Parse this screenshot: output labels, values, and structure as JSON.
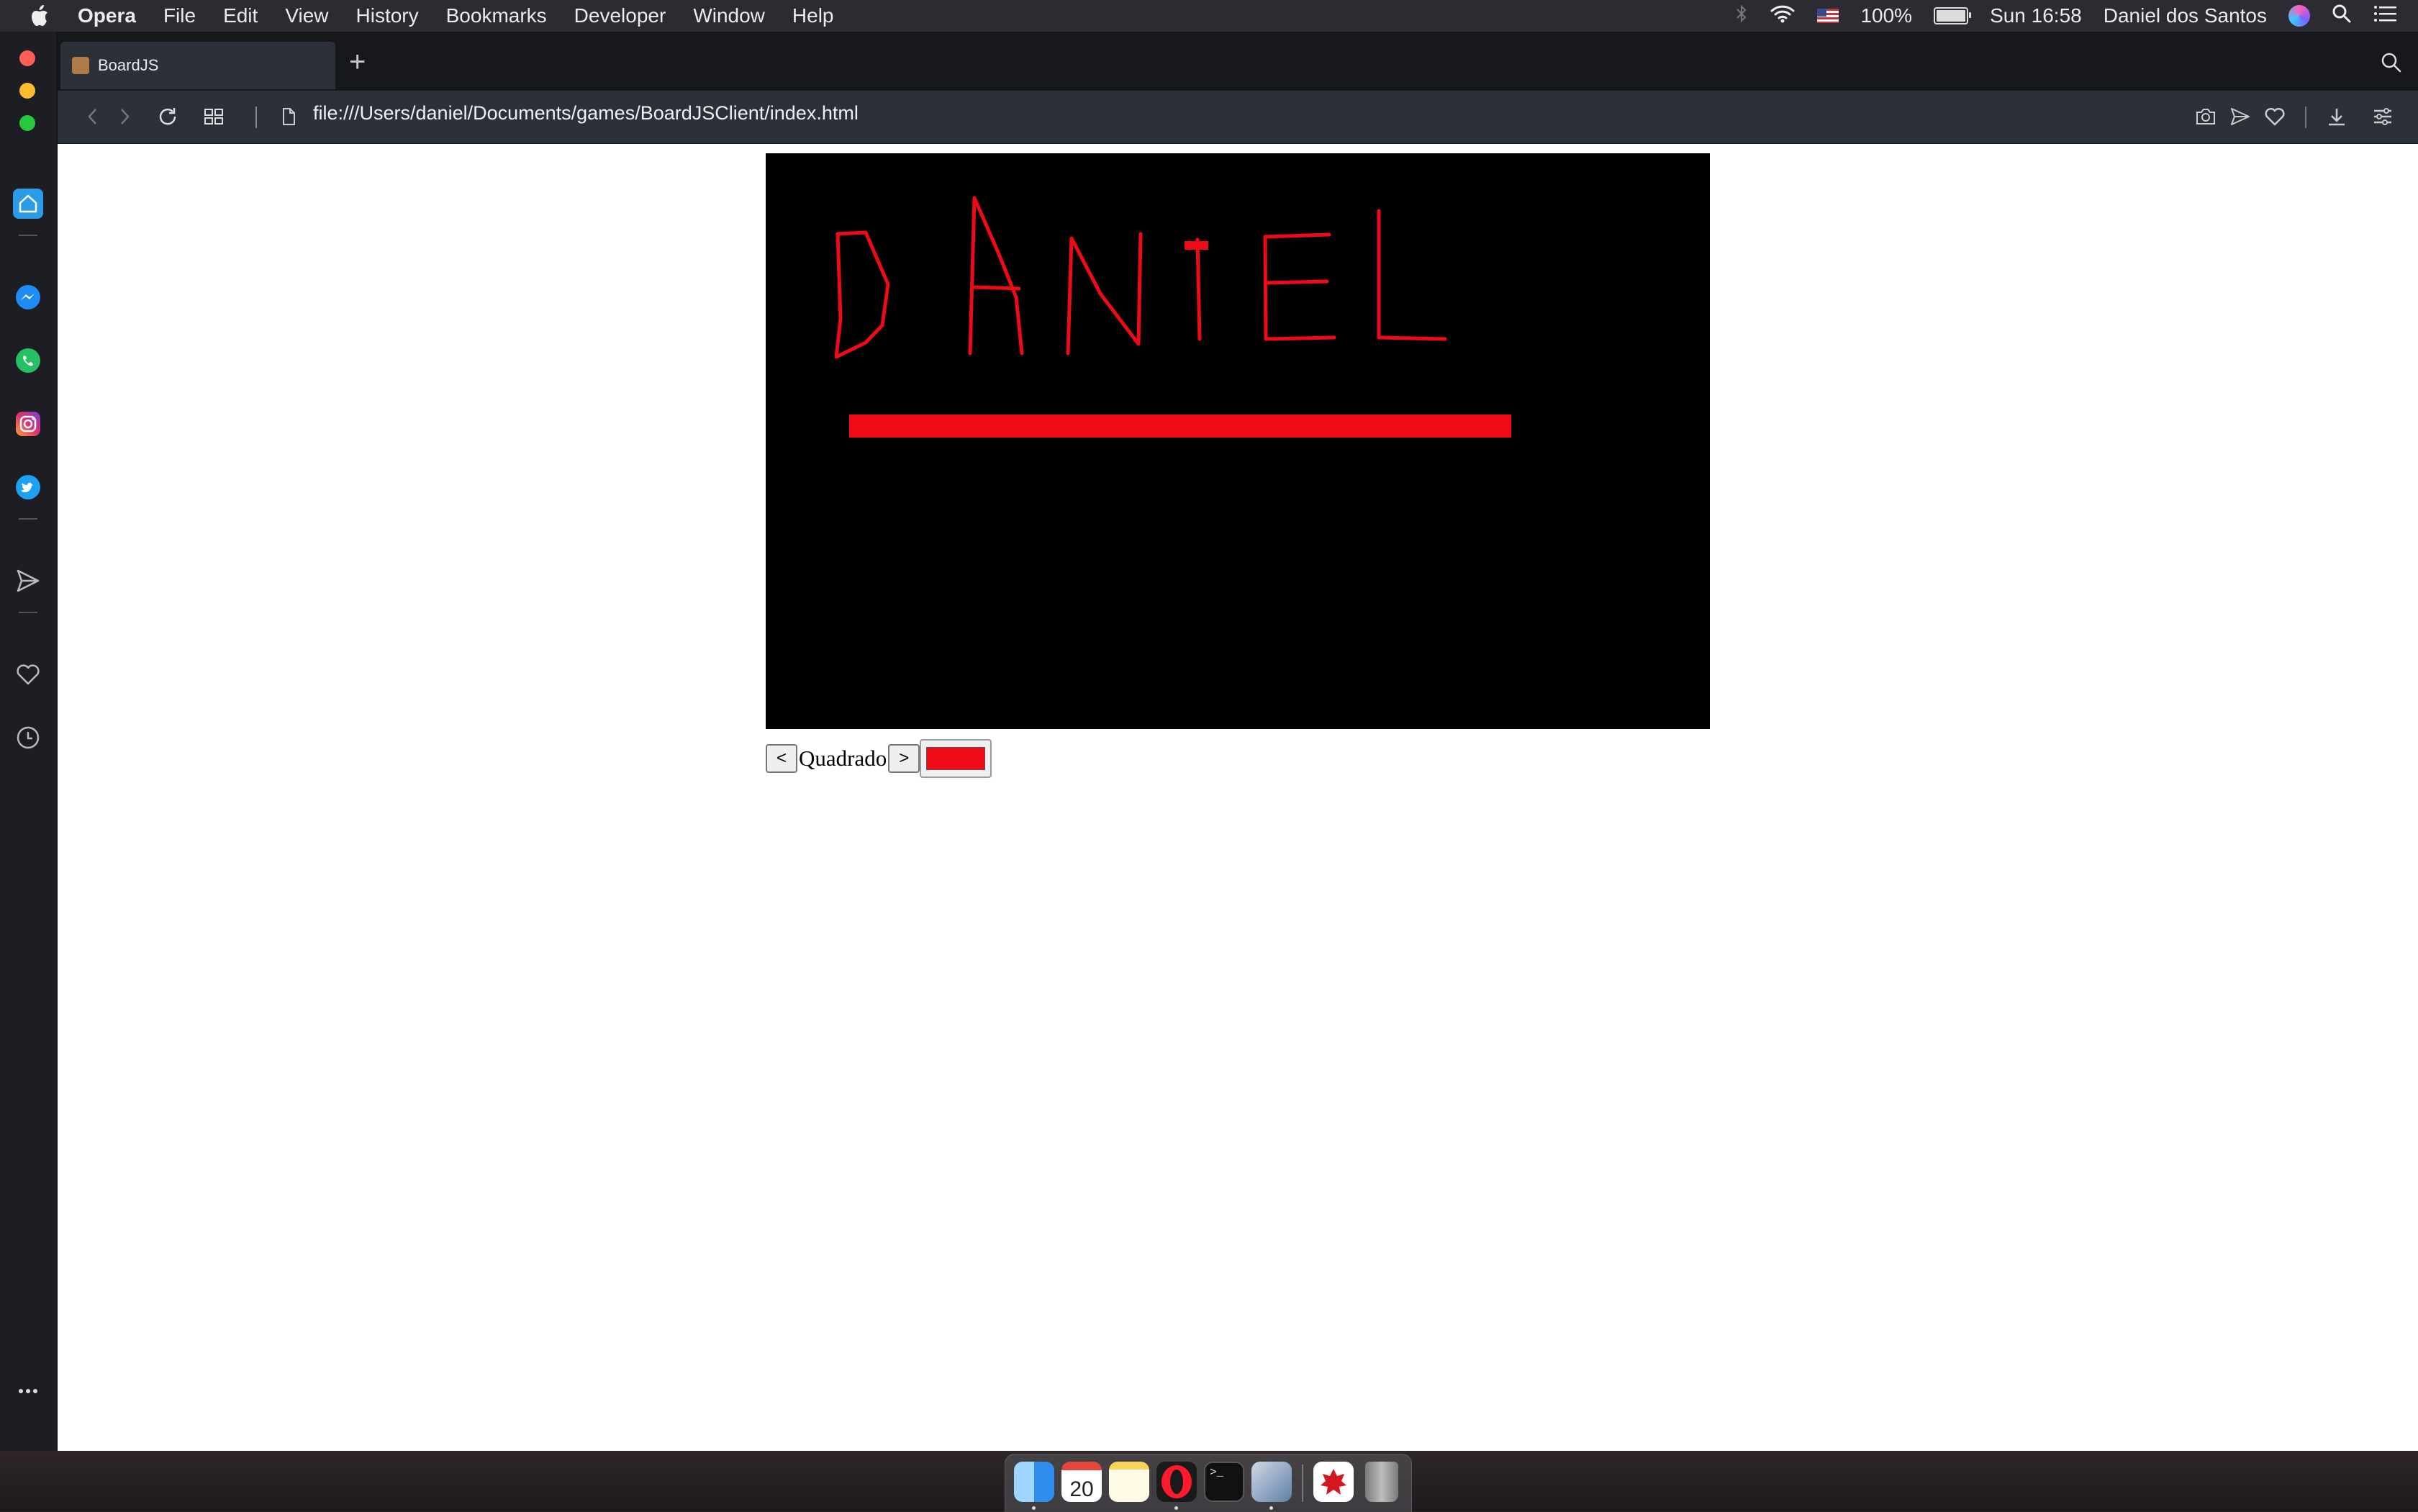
{
  "menubar": {
    "app_name": "Opera",
    "menus": [
      "File",
      "Edit",
      "View",
      "History",
      "Bookmarks",
      "Developer",
      "Window",
      "Help"
    ],
    "battery": "100%",
    "clock": "Sun 16:58",
    "user": "Daniel dos Santos"
  },
  "browser": {
    "tab_title": "BoardJS",
    "new_tab": "+",
    "url": "file:///Users/daniel/Documents/games/BoardJSClient/index.html"
  },
  "sidebar": {
    "items": [
      "home-icon",
      "messenger-icon",
      "whatsapp-icon",
      "instagram-icon",
      "twitter-icon",
      "flow-send-icon",
      "heart-icon",
      "history-clock-icon",
      "more-icon"
    ]
  },
  "page": {
    "canvas": {
      "background": "#000000",
      "stroke_color": "#ee0a17",
      "drawing": "DANiEL"
    },
    "prev_button": "<",
    "next_button": ">",
    "shape_label": "Quadrado",
    "current_color": "#ee0a17"
  },
  "dock": {
    "apps": [
      "finder-icon",
      "calendar-icon",
      "notes-icon",
      "opera-icon",
      "terminal-icon",
      "xcode-icon",
      "acrobat-icon",
      "trash-icon"
    ],
    "calendar_day": "20"
  }
}
